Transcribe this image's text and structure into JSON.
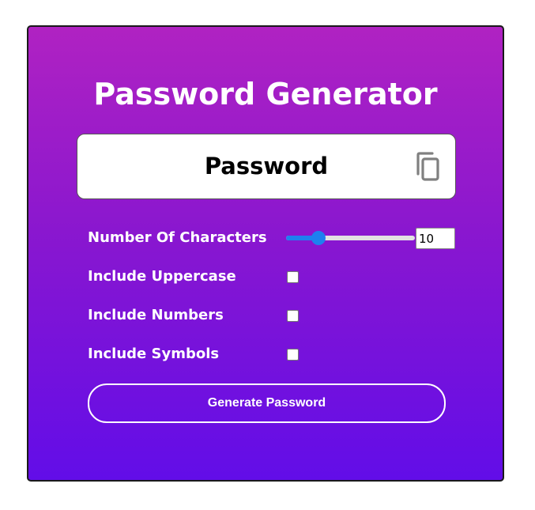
{
  "app": {
    "title": "Password Generator"
  },
  "password": {
    "text": "Password",
    "copy_icon": "copy-icon"
  },
  "options": {
    "characters": {
      "label": "Number Of Characters",
      "value": "10",
      "slider_fraction": 0.22
    },
    "uppercase": {
      "label": "Include Uppercase",
      "checked": false
    },
    "numbers": {
      "label": "Include Numbers",
      "checked": false
    },
    "symbols": {
      "label": "Include Symbols",
      "checked": false
    }
  },
  "actions": {
    "generate_label": "Generate Password"
  },
  "colors": {
    "gradient_top": "#b022c2",
    "gradient_bottom": "#620de8",
    "slider_accent": "#1e80ef",
    "text": "#ffffff"
  }
}
